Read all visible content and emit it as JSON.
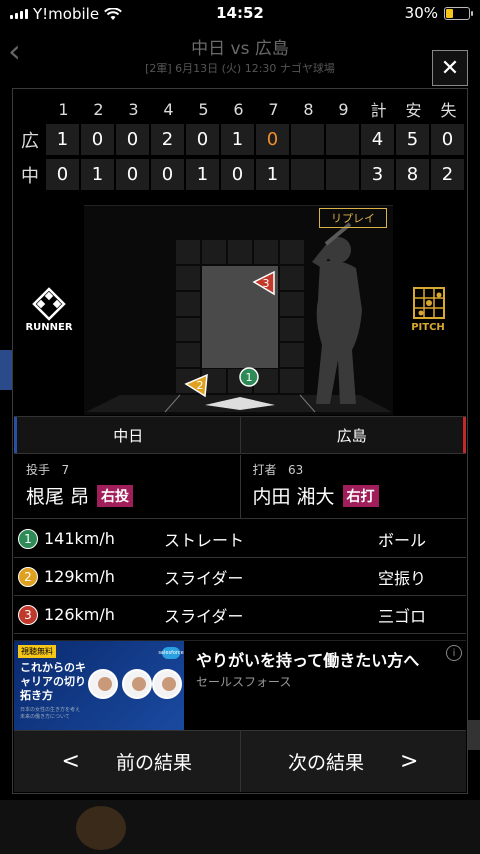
{
  "status_bar": {
    "carrier": "Y!mobile",
    "time": "14:52",
    "battery": "30%"
  },
  "bg_header": {
    "title": "中日 vs 広島",
    "subtitle": "[2軍] 6月13日 (火) 12:30 ナゴヤ球場"
  },
  "scoreboard": {
    "headers": [
      "1",
      "2",
      "3",
      "4",
      "5",
      "6",
      "7",
      "8",
      "9",
      "計",
      "安",
      "失"
    ],
    "rows": [
      {
        "team": "広",
        "innings": [
          "1",
          "0",
          "0",
          "2",
          "0",
          "1",
          "0",
          "",
          ""
        ],
        "totals": [
          "4",
          "5",
          "0"
        ]
      },
      {
        "team": "中",
        "innings": [
          "0",
          "1",
          "0",
          "0",
          "1",
          "0",
          "1",
          "",
          ""
        ],
        "totals": [
          "3",
          "8",
          "2"
        ]
      }
    ],
    "highlight_color": "#f08c2a"
  },
  "field": {
    "runner_label": "RUNNER",
    "pitch_label": "PITCH",
    "replay_label": "リプレイ"
  },
  "teams": {
    "left": "中日",
    "right": "広島",
    "left_color": "#2a4fa0",
    "right_color": "#c02a2a"
  },
  "pitcher": {
    "role": "投手",
    "number": "7",
    "name": "根尾 昂",
    "hand": "右投"
  },
  "batter": {
    "role": "打者",
    "number": "63",
    "name": "内田 湘大",
    "hand": "右打"
  },
  "pitches": [
    {
      "num": "1",
      "speed": "141km/h",
      "type": "ストレート",
      "result": "ボール",
      "color": "#2e8b57"
    },
    {
      "num": "2",
      "speed": "129km/h",
      "type": "スライダー",
      "result": "空振り",
      "color": "#e0a020"
    },
    {
      "num": "3",
      "speed": "126km/h",
      "type": "スライダー",
      "result": "三ゴロ",
      "color": "#c0392b"
    }
  ],
  "ad": {
    "tag": "視聴無料",
    "banner_headline": "これからのキャリアの切り拓き方",
    "banner_small": "日本の女性の生き方を考え未来の働き方について",
    "logo": "salesforce",
    "title": "やりがいを持って働きたい方へ",
    "sponsor": "セールスフォース",
    "info_icon": "i"
  },
  "nav": {
    "prev": "前の結果",
    "next": "次の結果",
    "prev_arrow": "<",
    "next_arrow": ">"
  },
  "close_symbol": "✕"
}
